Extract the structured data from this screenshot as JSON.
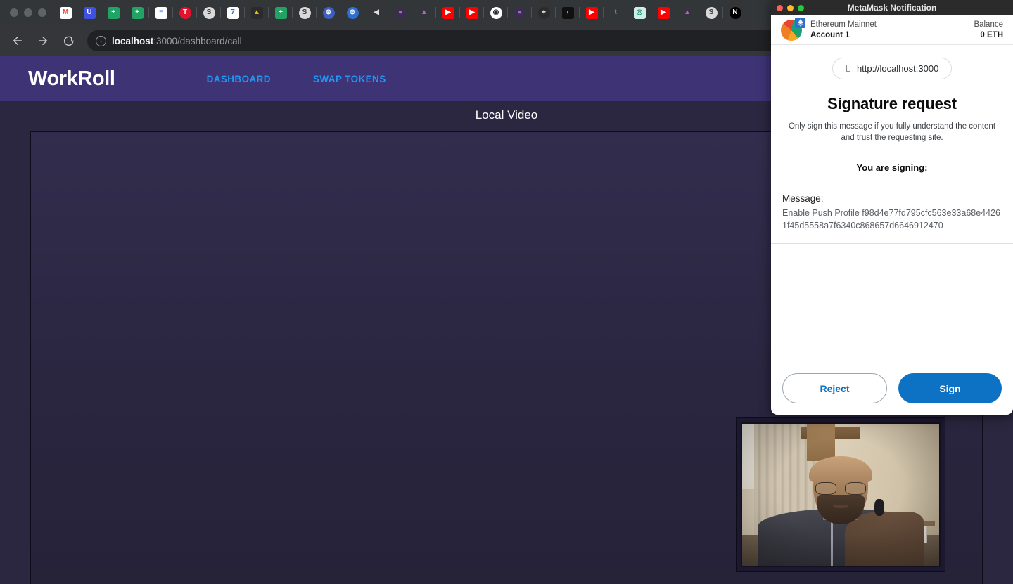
{
  "browser": {
    "traffic_lights": [
      "close",
      "minimize",
      "zoom"
    ],
    "nav": {
      "back": "←",
      "forward": "→",
      "reload": "⟳"
    },
    "omnibox": {
      "info_icon": "ⓘ",
      "url_host": "localhost",
      "url_rest": ":3000/dashboard/call",
      "full_url": "localhost:3000/dashboard/call"
    },
    "pinned_tabs": [
      {
        "name": "gmail",
        "glyph": "M",
        "bg": "#ffffff",
        "fg": "#ea4335",
        "shape": "square"
      },
      {
        "name": "udemy",
        "glyph": "U",
        "bg": "#3f51e0",
        "fg": "#ffffff",
        "shape": "square"
      },
      {
        "name": "google-sheets",
        "glyph": "+",
        "bg": "#21a366",
        "fg": "#ffffff",
        "shape": "square"
      },
      {
        "name": "google-sheets-2",
        "glyph": "+",
        "bg": "#21a366",
        "fg": "#ffffff",
        "shape": "square"
      },
      {
        "name": "google-docs",
        "glyph": "≡",
        "bg": "#ffffff",
        "fg": "#4285f4",
        "shape": "square"
      },
      {
        "name": "tup",
        "glyph": "T",
        "bg": "#e8112d",
        "fg": "#ffffff",
        "shape": "circle"
      },
      {
        "name": "swirl-app",
        "glyph": "S",
        "bg": "#d9d9d9",
        "fg": "#3a3a3a",
        "shape": "circle"
      },
      {
        "name": "google-calendar",
        "glyph": "7",
        "bg": "#ffffff",
        "fg": "#1a73e8",
        "shape": "square"
      },
      {
        "name": "google-drive",
        "glyph": "▲",
        "bg": "#2b2b2b",
        "fg": "#fbbc04",
        "shape": "square"
      },
      {
        "name": "google-sheets-3",
        "glyph": "+",
        "bg": "#21a366",
        "fg": "#ffffff",
        "shape": "square"
      },
      {
        "name": "swirl-app-2",
        "glyph": "S",
        "bg": "#d9d9d9",
        "fg": "#3a3a3a",
        "shape": "circle"
      },
      {
        "name": "globe-blue",
        "glyph": "⊜",
        "bg": "#3f5fbf",
        "fg": "#ffffff",
        "shape": "circle"
      },
      {
        "name": "globe-blue-2",
        "glyph": "⊝",
        "bg": "#2f6fd0",
        "fg": "#ffffff",
        "shape": "circle"
      },
      {
        "name": "speaker",
        "glyph": "◀",
        "bg": "#323639",
        "fg": "#dddddd",
        "shape": "square"
      },
      {
        "name": "purple-orb",
        "glyph": "●",
        "bg": "#3a2f4a",
        "fg": "#a463d8",
        "shape": "circle"
      },
      {
        "name": "bell-purple",
        "glyph": "▲",
        "bg": "#323639",
        "fg": "#c155e8",
        "shape": "square"
      },
      {
        "name": "youtube",
        "glyph": "▶",
        "bg": "#ff0000",
        "fg": "#ffffff",
        "shape": "square"
      },
      {
        "name": "youtube-2",
        "glyph": "▶",
        "bg": "#ff0000",
        "fg": "#ffffff",
        "shape": "square"
      },
      {
        "name": "github",
        "glyph": "◉",
        "bg": "#ffffff",
        "fg": "#24292e",
        "shape": "circle"
      },
      {
        "name": "purple-orb-2",
        "glyph": "●",
        "bg": "#3a2f4a",
        "fg": "#a463d8",
        "shape": "circle"
      },
      {
        "name": "dark-circle",
        "glyph": "⌖",
        "bg": "#2b2b2b",
        "fg": "#dddddd",
        "shape": "circle"
      },
      {
        "name": "leaf-green",
        "glyph": "◗",
        "bg": "#111111",
        "fg": "#2ecc71",
        "shape": "square"
      },
      {
        "name": "youtube-3",
        "glyph": "▶",
        "bg": "#ff0000",
        "fg": "#ffffff",
        "shape": "square"
      },
      {
        "name": "tumblr",
        "glyph": "t",
        "bg": "#323639",
        "fg": "#4a90e2",
        "shape": "square"
      },
      {
        "name": "teal-app",
        "glyph": "◎",
        "bg": "#cfeee4",
        "fg": "#2b8f73",
        "shape": "square"
      },
      {
        "name": "youtube-4",
        "glyph": "▶",
        "bg": "#ff0000",
        "fg": "#ffffff",
        "shape": "square"
      },
      {
        "name": "bell-purple-2",
        "glyph": "▲",
        "bg": "#323639",
        "fg": "#c155e8",
        "shape": "square"
      },
      {
        "name": "swirl-app-3",
        "glyph": "S",
        "bg": "#d9d9d9",
        "fg": "#3a3a3a",
        "shape": "circle"
      },
      {
        "name": "nextjs",
        "glyph": "N",
        "bg": "#000000",
        "fg": "#ffffff",
        "shape": "circle"
      }
    ]
  },
  "app": {
    "brand": "WorkRoll",
    "nav": [
      {
        "label": "DASHBOARD",
        "name": "dashboard"
      },
      {
        "label": "SWAP TOKENS",
        "name": "swap-tokens"
      }
    ],
    "video_label": "Local Video",
    "colors": {
      "header_purple": "#3d3375",
      "page_bg": "#2b2740",
      "accent_blue": "#2196f3"
    }
  },
  "metamask": {
    "window_title": "MetaMask Notification",
    "traffic_lights": {
      "close": "#ff5f57",
      "minimize": "#febc2e",
      "zoom": "#28c840"
    },
    "network": "Ethereum Mainnet",
    "account_name": "Account 1",
    "balance_label": "Balance",
    "balance_value": "0 ETH",
    "site_favicon_letter": "L",
    "site_url": "http://localhost:3000",
    "heading": "Signature request",
    "subtitle": "Only sign this message if you fully understand the content and trust the requesting site.",
    "signing_label": "You are signing:",
    "message_label": "Message:",
    "message_value": "Enable Push Profile f98d4e77fd795cfc563e33a68e44261f45d5558a7f6340c868657d6646912470",
    "buttons": {
      "reject": "Reject",
      "sign": "Sign"
    },
    "colors": {
      "primary": "#0d72c4",
      "reject_text": "#0b6fc4"
    }
  }
}
